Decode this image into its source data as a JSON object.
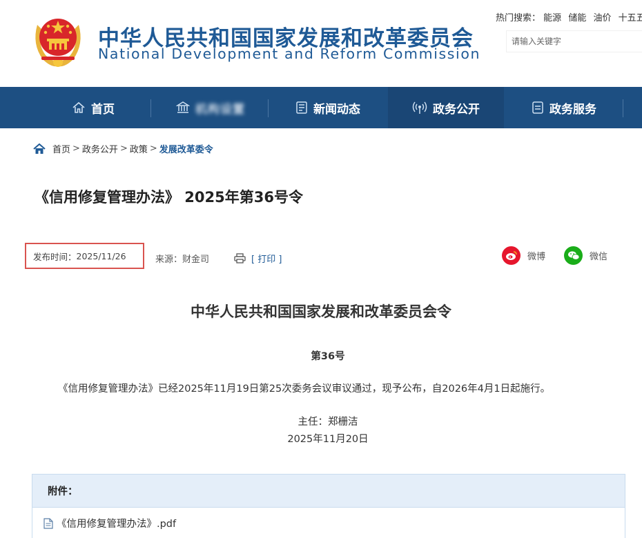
{
  "header": {
    "title_cn": "中华人民共和国国家发展和改革委员会",
    "title_en": "National Development and Reform Commission",
    "hot_search_label": "热门搜索：",
    "hot_search_terms": [
      "能源",
      "储能",
      "油价",
      "十五五"
    ],
    "search_placeholder": "请输入关键字"
  },
  "nav": {
    "items": [
      {
        "label": "首页",
        "icon": "home-icon"
      },
      {
        "label": "机构设置",
        "icon": "building-icon",
        "obscured": true
      },
      {
        "label": "新闻动态",
        "icon": "news-icon"
      },
      {
        "label": "政务公开",
        "icon": "broadcast-icon",
        "active": true
      },
      {
        "label": "政务服务",
        "icon": "service-icon"
      }
    ]
  },
  "breadcrumb": {
    "items": [
      "首页",
      "政务公开",
      "政策",
      "发展改革委令"
    ],
    "separator": ">"
  },
  "article": {
    "title": "《信用修复管理办法》 2025年第36号令",
    "publish_label": "发布时间：",
    "publish_date": "2025/11/26",
    "source_label": "来源：",
    "source": "财金司",
    "print_label": "[ 打印 ]",
    "share_weibo": "微博",
    "share_wechat": "微信"
  },
  "document": {
    "heading": "中华人民共和国国家发展和改革委员会令",
    "number": "第36号",
    "body": "《信用修复管理办法》已经2025年11月19日第25次委务会议审议通过，现予公布，自2026年4月1日起施行。",
    "signatory": "主任：郑栅洁",
    "sign_date": "2025年11月20日"
  },
  "attachments": {
    "heading": "附件：",
    "files": [
      "《信用修复管理办法》.pdf"
    ]
  },
  "colors": {
    "brand_blue": "#1f5a96",
    "nav_bg": "#1d4f82",
    "highlight_red": "#d9534f",
    "weibo_red": "#e6162d",
    "wechat_green": "#1aad19"
  }
}
